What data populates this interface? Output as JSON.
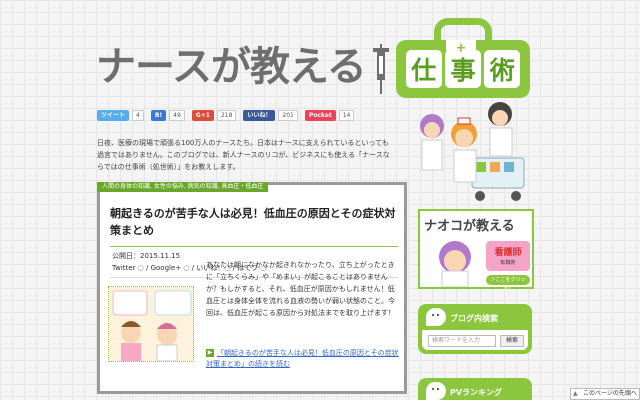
{
  "site": {
    "title": "ナースが教える",
    "bag_chars": [
      "仕",
      "事",
      "術"
    ],
    "bag_cross": "+"
  },
  "social": [
    {
      "label": "ツイート",
      "count": "4",
      "color": "#55acee"
    },
    {
      "label": "B!",
      "count": "49",
      "color": "#3c78d8"
    },
    {
      "label": "G+1",
      "count": "218",
      "color": "#dd4b39"
    },
    {
      "label": "いいね！",
      "count": "201",
      "color": "#3b5998"
    },
    {
      "label": "Pocket",
      "count": "14",
      "color": "#ee4056"
    }
  ],
  "intro": "日夜、医療の現場で頑張る100万人のナースたち。日本はナースに支えられているといっても過言ではありません。このブログでは、新人ナースのリコが、ビジネスにも使える「ナースならではの仕事術（処世術）」をお教えします。",
  "article": {
    "category": "人間の身体の知識, 女性の悩み, 病気の知識, 高血圧・低血圧",
    "title": "朝起きるのが苦手な人は必見！低血圧の原因とその症状対策まとめ",
    "date": "公開日：2015.11.15",
    "share": "Twitter ◌ / Google+ ◌ / いいね！◌ / はてブ ◌",
    "excerpt": "あなたは朝になかなか起きれなかったり、立ち上がったときに「立ちくらみ」や「めまい」が起こることはありませんか？もしかすると、それ、低血圧が原因かもしれません！低血圧とは身体全体を流れる血液の勢いが弱い状態のこと。今回は、低血圧が起こる原因から対処法までを取り上げます！",
    "continue": "「朝起きるのが苦手な人は必見！低血圧の原因とその症状対策まとめ」の続きを読む",
    "continue_icon": "▶"
  },
  "sidebar": {
    "naoko_title": "ナオコが教える",
    "naoko_badge": "看護師",
    "naoko_sub": "転職術",
    "naoko_footer": "＞ここをクリック！",
    "search_title": "ブログ内検索",
    "search_placeholder": "検索ワードを入力",
    "search_button": "検索",
    "ranking_title": "PVランキング"
  },
  "footer_link": "このページの先頭へ"
}
